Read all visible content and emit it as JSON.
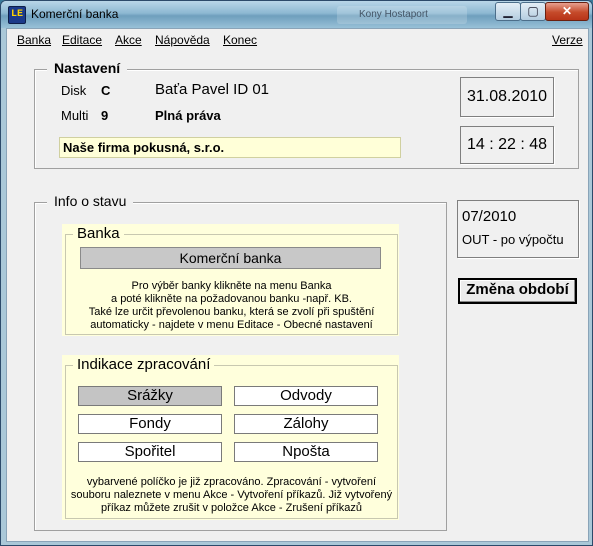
{
  "window": {
    "icon_text": "LE",
    "title": "Komerční banka",
    "background_title": "Kony Hostaport",
    "min_glyph": "▁",
    "max_glyph": "▢",
    "close_glyph": "✕"
  },
  "menu": {
    "banka": "Banka",
    "editace": "Editace",
    "akce": "Akce",
    "napoveda": "Nápověda",
    "konec": "Konec",
    "verze": "Verze"
  },
  "nastaveni": {
    "title": "Nastavení",
    "disk_label": "Disk",
    "disk_value": "C",
    "user": "Baťa Pavel ID 01",
    "multi_label": "Multi",
    "multi_value": "9",
    "rights": "Plná práva",
    "company": "Naše firma pokusná, s.r.o.",
    "date": "31.08.2010",
    "time": "14 : 22 : 48"
  },
  "info": {
    "title": "Info o stavu",
    "period": "07/2010",
    "status": "OUT - po výpočtu",
    "change_period_button": "Změna období"
  },
  "banka": {
    "title": "Banka",
    "selected_bank": "Komerční banka",
    "help_lines": [
      "Pro výběr banky klikněte na menu Banka",
      "a poté klikněte na požadovanou banku -např. KB.",
      "Také lze určit převolenou banku, která se zvolí při  spuštění",
      "automaticky - najdete v menu Editace - Obecné nastavení"
    ]
  },
  "indikace": {
    "title": "Indikace zpracování",
    "items": [
      {
        "label": "Srážky",
        "done": true
      },
      {
        "label": "Odvody",
        "done": false
      },
      {
        "label": "Fondy",
        "done": false
      },
      {
        "label": "Zálohy",
        "done": false
      },
      {
        "label": "Spořitel",
        "done": false
      },
      {
        "label": "Npošta",
        "done": false
      }
    ],
    "help_lines": [
      "vybarvené políčko je již zpracováno. Zpracování - vytvoření",
      "souboru naleznete v menu Akce - Vytvoření příkazů. Již vytvořený",
      "příkaz můžete zrušit v položce Akce - Zrušení příkazů"
    ]
  },
  "colors": {
    "yellow_panel": "#ffffdc",
    "processed_fill": "#c4c4c4"
  }
}
